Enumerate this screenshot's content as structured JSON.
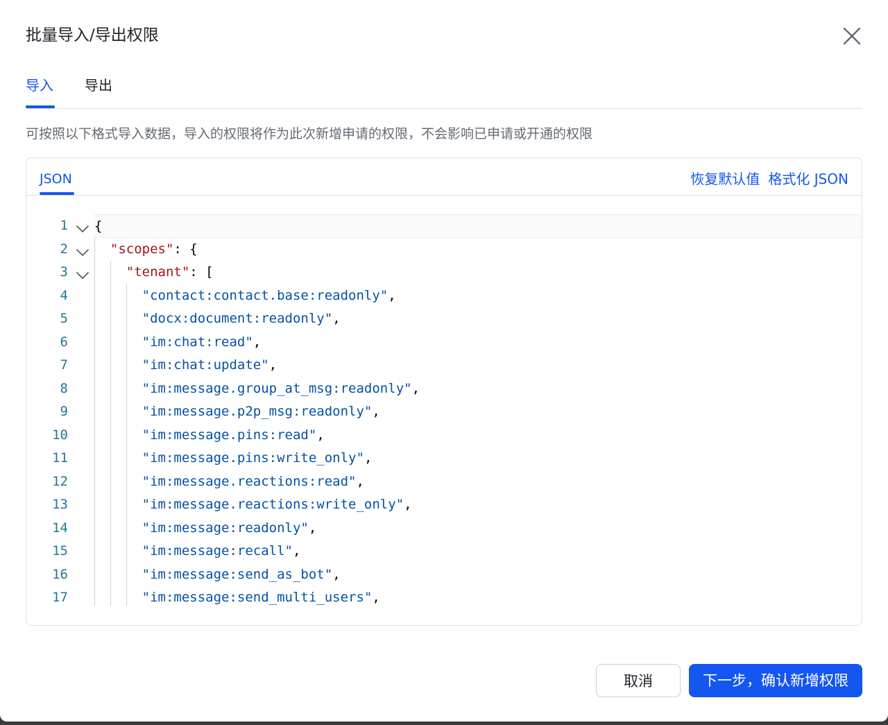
{
  "dialog": {
    "title": "批量导入/导出权限",
    "close_icon": "close-icon"
  },
  "tabs": [
    {
      "label": "导入",
      "active": true
    },
    {
      "label": "导出",
      "active": false
    }
  ],
  "description": "可按照以下格式导入数据，导入的权限将作为此次新增申请的权限，不会影响已申请或开通的权限",
  "editor": {
    "tab_label": "JSON",
    "restore_default_label": "恢复默认值",
    "format_json_label": "格式化 JSON",
    "lines": [
      {
        "num": "1",
        "text": "{"
      },
      {
        "num": "2",
        "text": "  \"scopes\": {"
      },
      {
        "num": "3",
        "text": "    \"tenant\": ["
      },
      {
        "num": "4",
        "text": "      \"contact:contact.base:readonly\","
      },
      {
        "num": "5",
        "text": "      \"docx:document:readonly\","
      },
      {
        "num": "6",
        "text": "      \"im:chat:read\","
      },
      {
        "num": "7",
        "text": "      \"im:chat:update\","
      },
      {
        "num": "8",
        "text": "      \"im:message.group_at_msg:readonly\","
      },
      {
        "num": "9",
        "text": "      \"im:message.p2p_msg:readonly\","
      },
      {
        "num": "10",
        "text": "      \"im:message.pins:read\","
      },
      {
        "num": "11",
        "text": "      \"im:message.pins:write_only\","
      },
      {
        "num": "12",
        "text": "      \"im:message.reactions:read\","
      },
      {
        "num": "13",
        "text": "      \"im:message.reactions:write_only\","
      },
      {
        "num": "14",
        "text": "      \"im:message:readonly\","
      },
      {
        "num": "15",
        "text": "      \"im:message:recall\","
      },
      {
        "num": "16",
        "text": "      \"im:message:send_as_bot\","
      },
      {
        "num": "17",
        "text": "      \"im:message:send_multi_users\","
      }
    ]
  },
  "footer": {
    "cancel_label": "取消",
    "next_label": "下一步，确认新增权限"
  },
  "colors": {
    "accent": "#1456f0",
    "key": "#a31515",
    "string": "#0451a5",
    "line_number": "#237893"
  }
}
